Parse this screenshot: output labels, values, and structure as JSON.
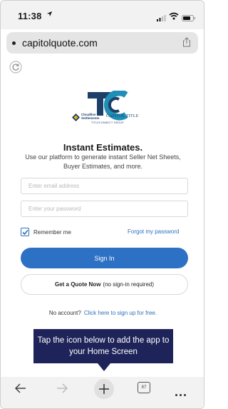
{
  "status_bar": {
    "time": "11:38"
  },
  "browser": {
    "url": "capitolquote.com"
  },
  "logo": {
    "sub_text": "TITLECONNECT GROUP",
    "brand_a": "Cloudline Settlements",
    "brand_b": "CAPITOL TITLE"
  },
  "main": {
    "heading": "Instant Estimates.",
    "subtext": "Use our platform to generate instant Seller Net Sheets, Buyer Estimates, and more.",
    "email_placeholder": "Enter email address",
    "password_placeholder": "Enter your password",
    "remember_label": "Remember me",
    "remember_checked": true,
    "forgot_link": "Forgot my password",
    "signin_label": "Sign In",
    "quote_bold": "Get a Quote Now",
    "quote_rest": "(no sign-in required)",
    "no_account": "No account?",
    "signup_link": "Click here to sign up for free."
  },
  "tooltip": {
    "text": "Tap the icon below to add the app to your Home Screen"
  },
  "toolbar": {
    "tab_count": "87"
  },
  "colors": {
    "primary": "#2d71c4",
    "tooltip_bg": "#1e2459",
    "brand_navy": "#1d3f68",
    "link": "#2c6fbf"
  }
}
